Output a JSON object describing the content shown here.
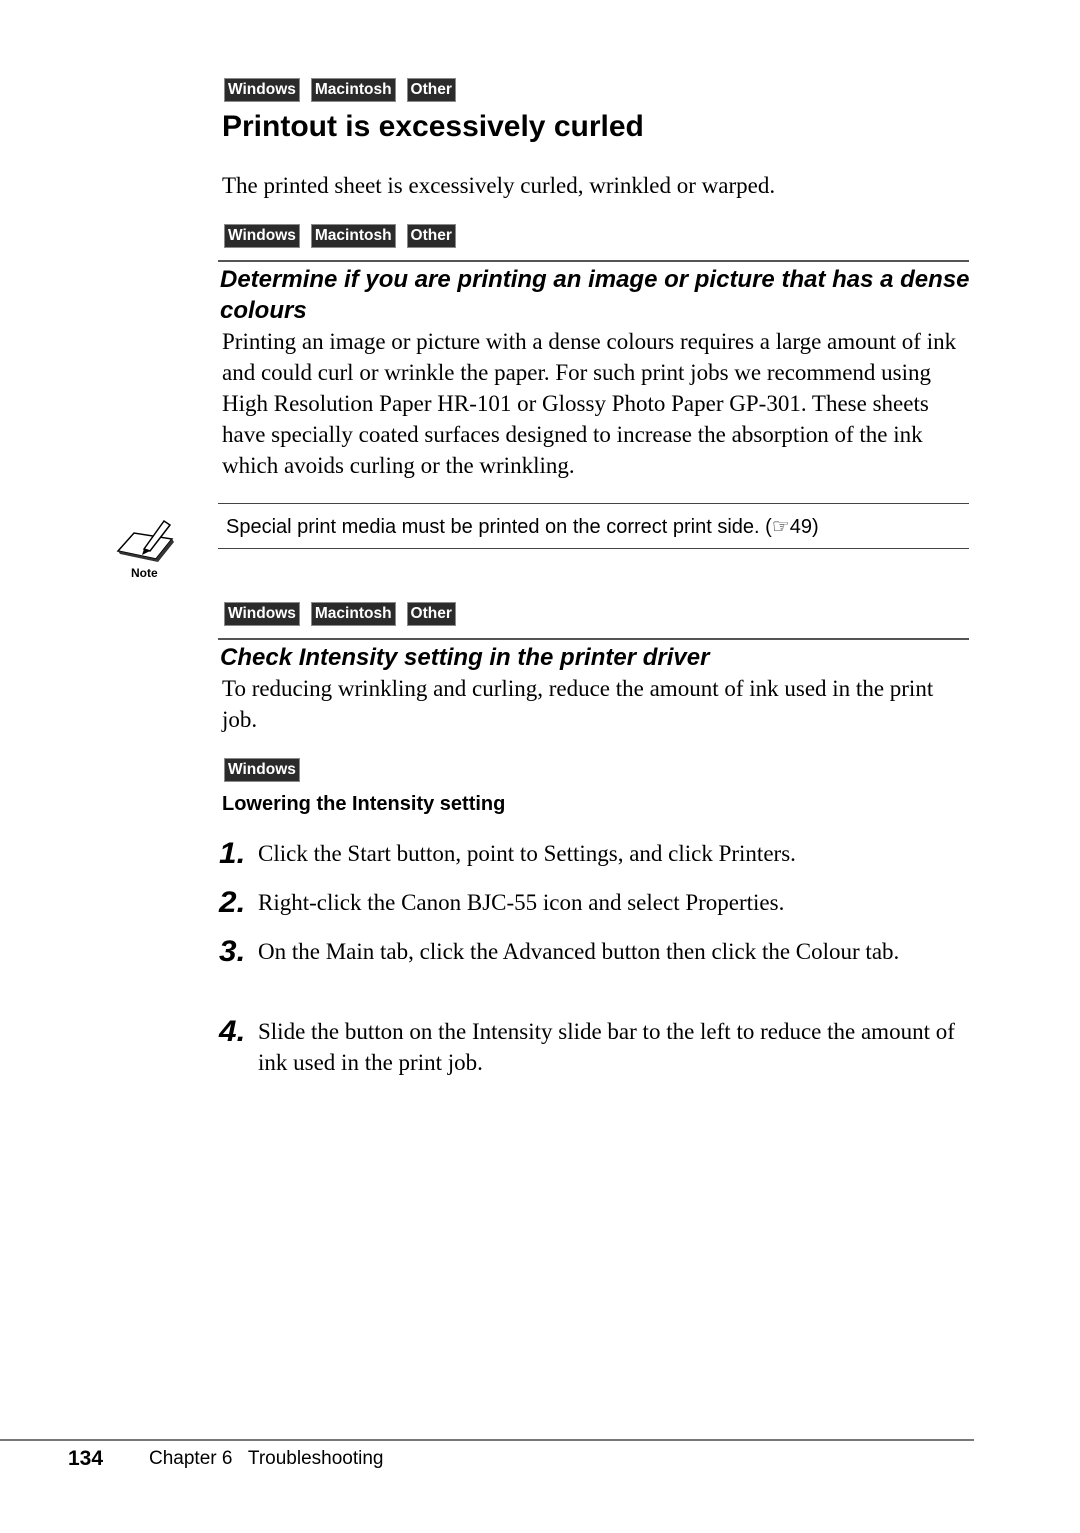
{
  "platform_tags": {
    "windows": "Windows",
    "macintosh": "Macintosh",
    "other": "Other"
  },
  "title": "Printout is excessively curled",
  "intro": "The printed sheet is excessively curled, wrinkled or warped.",
  "section1": {
    "heading": "Determine if you are printing an image or picture that has a dense colours",
    "body": "Printing an image or picture with a dense colours requires a large amount of ink and could curl or wrinkle the paper.  For such print jobs we recommend using High Resolution Paper HR-101 or Glossy Photo Paper GP-301.  These sheets have specially coated surfaces designed to increase the absorption of the ink which avoids curling or the wrinkling."
  },
  "note": {
    "label": "Note",
    "icon": "pencil-note-icon",
    "text": "Special print media must be printed on the correct print side. (☞49)"
  },
  "section2": {
    "heading": "Check Intensity setting in the printer driver",
    "body": "To reducing wrinkling and curling, reduce the amount of ink used in the print job."
  },
  "procedure": {
    "heading": "Lowering the Intensity setting",
    "steps": [
      {
        "num": "1.",
        "text": "Click the Start button, point to Settings, and click Printers."
      },
      {
        "num": "2.",
        "text": "Right-click the Canon BJC-55 icon and select Properties."
      },
      {
        "num": "3.",
        "text": "On the Main tab, click the Advanced button then click the Colour tab."
      },
      {
        "num": "4.",
        "text": "Slide the button on the Intensity slide bar to the left to reduce the amount of ink used in the print job."
      }
    ]
  },
  "footer": {
    "page_number": "134",
    "chapter": "Chapter 6   Troubleshooting"
  }
}
